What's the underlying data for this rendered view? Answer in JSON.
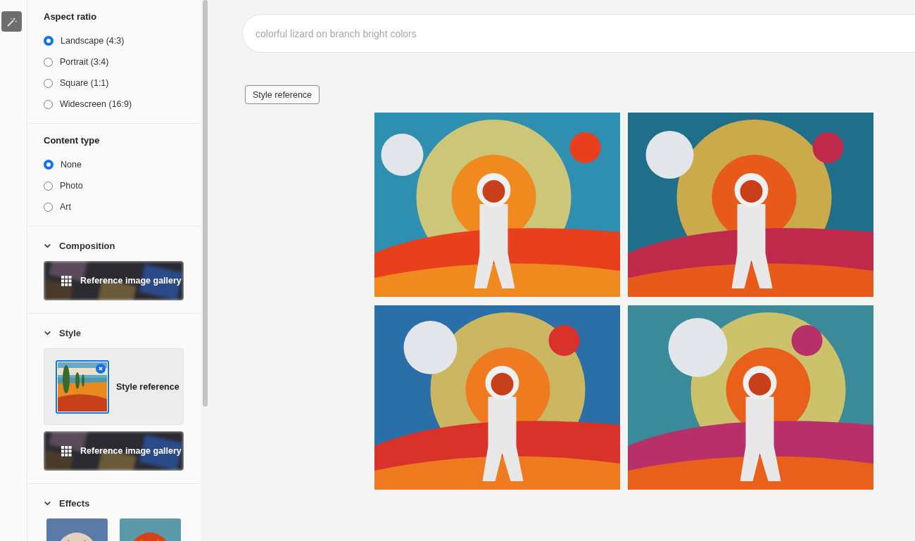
{
  "sidebar": {
    "sections": [
      {
        "kind": "radio",
        "title": "Aspect ratio",
        "options": [
          {
            "label": "Landscape (4:3)",
            "selected": true
          },
          {
            "label": "Portrait (3:4)",
            "selected": false
          },
          {
            "label": "Square (1:1)",
            "selected": false
          },
          {
            "label": "Widescreen (16:9)",
            "selected": false
          }
        ]
      },
      {
        "kind": "radio",
        "title": "Content type",
        "options": [
          {
            "label": "None",
            "selected": true
          },
          {
            "label": "Photo",
            "selected": false
          },
          {
            "label": "Art",
            "selected": false
          }
        ]
      },
      {
        "kind": "gallery",
        "title": "Composition",
        "expanded": true,
        "button": "Reference image gallery"
      },
      {
        "kind": "style",
        "title": "Style",
        "expanded": true,
        "reference": "Style reference",
        "button": "Reference image gallery"
      },
      {
        "kind": "effects",
        "title": "Effects",
        "expanded": true
      }
    ]
  },
  "search": {
    "placeholder": "colorful lizard on branch bright colors"
  },
  "style_chip": "Style reference"
}
